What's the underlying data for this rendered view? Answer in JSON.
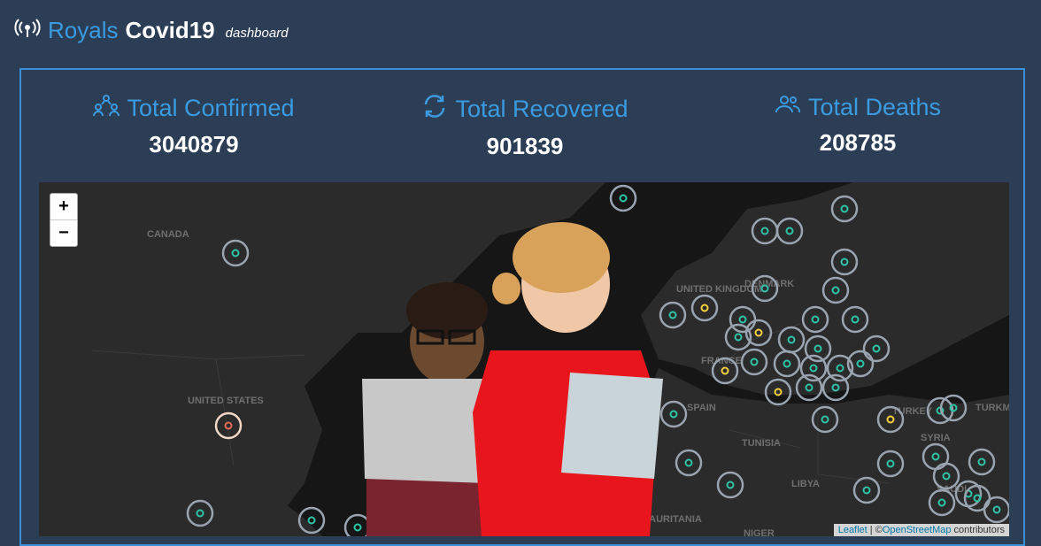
{
  "brand": {
    "royals": "Royals",
    "covid": "Covid19",
    "dashboard": "dashboard"
  },
  "stats": {
    "confirmed": {
      "label": "Total Confirmed",
      "value": "3040879"
    },
    "recovered": {
      "label": "Total Recovered",
      "value": "901839"
    },
    "deaths": {
      "label": "Total Deaths",
      "value": "208785"
    }
  },
  "map": {
    "zoom_in": "+",
    "zoom_out": "−",
    "labels": [
      "CANADA",
      "UNITED STATES",
      "UNITED KINGDOM",
      "DENMARK",
      "FRANCE",
      "SPAIN",
      "TUNISIA",
      "LIBYA",
      "TURKEY",
      "SYRIA",
      "TURKM",
      "MAURITANIA",
      "NIGER",
      "SAUDI"
    ],
    "attribution": {
      "leaflet": "Leaflet",
      "separator": " | ©",
      "osm": "OpenStreetMap",
      "suffix": " contributors"
    }
  },
  "colors": {
    "accent": "#3a9be0",
    "background": "#2c3e55",
    "marker": "#2ec4a6",
    "marker_highlight": "#f4d03f"
  }
}
